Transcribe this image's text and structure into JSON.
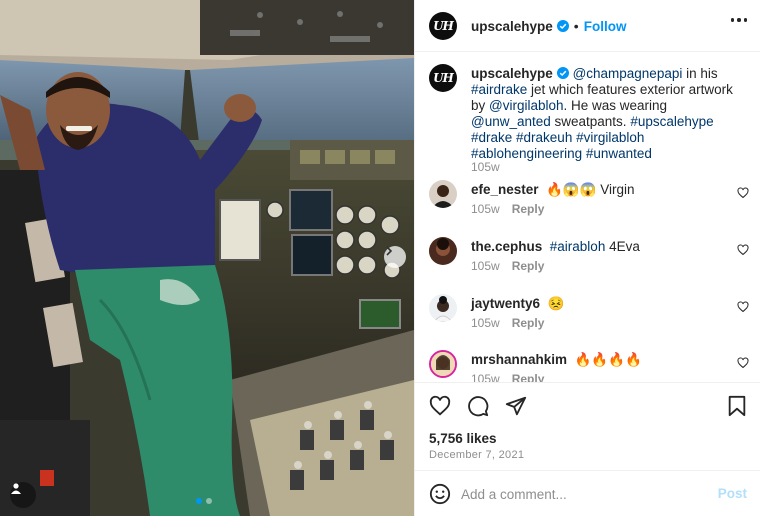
{
  "post": {
    "account": "upscalehype",
    "avatar_text": "UH",
    "follow_label": "Follow",
    "dot": "•",
    "caption": {
      "username": "upscalehype",
      "mention_1": "@champagnepapi",
      "t1": " in his ",
      "tag_airdrake": "#airdrake",
      "t2": " jet which features exterior artwork by ",
      "mention_2": "@virgilabloh",
      "t3": ". He was wearing ",
      "mention_3": "@unw_anted",
      "t4": " sweatpants. ",
      "tags": "#upscalehype #drake #drakeuh #virgilabloh #ablohengineering #unwanted",
      "time": "105w"
    },
    "likes": "5,756 likes",
    "date": "December 7, 2021"
  },
  "comments": [
    {
      "username": "efe_nester",
      "text": "🔥😱😱 Virgin",
      "time": "105w",
      "reply": "Reply"
    },
    {
      "username": "the.cephus",
      "tag": "#airabloh",
      "text": " 4Eva",
      "time": "105w",
      "reply": "Reply"
    },
    {
      "username": "jaytwenty6",
      "text": "😣",
      "time": "105w",
      "reply": "Reply"
    },
    {
      "username": "mrshannahkim",
      "text": "🔥🔥🔥🔥",
      "time": "105w",
      "reply": "Reply"
    }
  ],
  "composer": {
    "placeholder": "Add a comment...",
    "post_label": "Post"
  },
  "icons": {
    "verified": "verified-badge-icon",
    "more": "more-options-icon",
    "like": "heart-icon",
    "comment": "comment-bubble-icon",
    "share": "paper-plane-icon",
    "save": "bookmark-icon",
    "emoji": "smiley-icon",
    "next": "chevron-right-icon",
    "tagged": "user-tag-icon"
  },
  "colors": {
    "link_blue": "#0095f6",
    "hashtag": "#00376b",
    "muted": "#8e8e8e",
    "post_disabled": "#b2dffc"
  },
  "carousel": {
    "slides": 2,
    "active": 1
  }
}
